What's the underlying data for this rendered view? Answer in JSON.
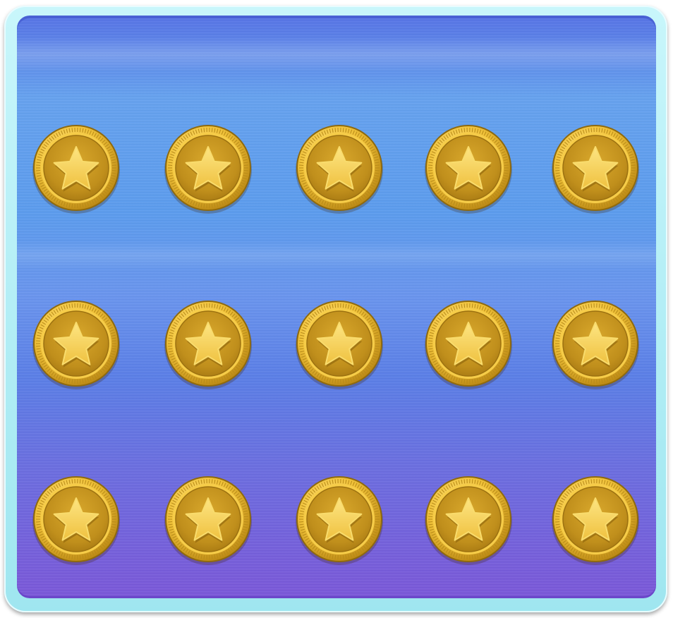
{
  "board": {
    "rows": 3,
    "columns": 5,
    "coin_icon": "star-coin-icon",
    "colors": {
      "frame": "#a8ecf3",
      "board_top": "#5774e6",
      "board_bottom": "#7b58d9",
      "coin_gold": "#e8b82e",
      "coin_dark": "#a97a12",
      "star": "#f7d35a"
    }
  }
}
